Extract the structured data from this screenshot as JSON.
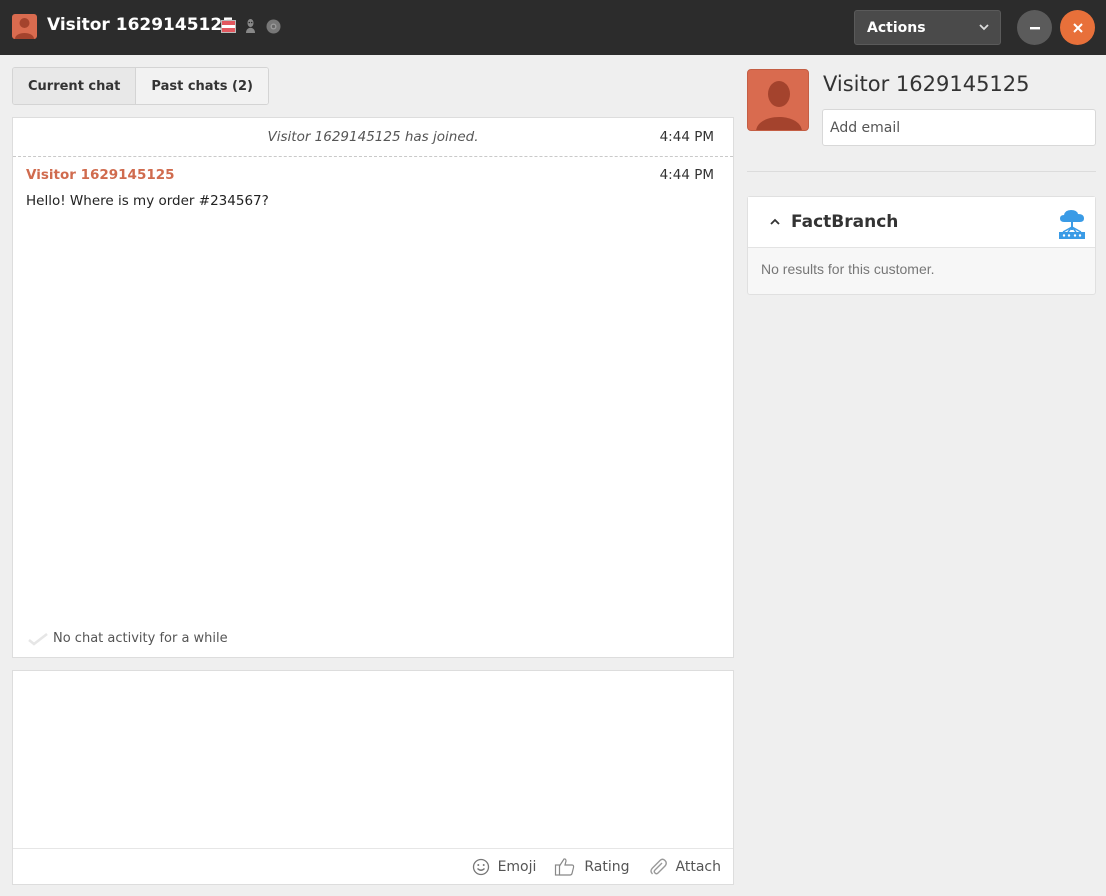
{
  "window": {
    "title": "Visitor 1629145125",
    "actions_label": "Actions"
  },
  "tabs": [
    {
      "label": "Current chat"
    },
    {
      "label": "Past chats (2)"
    }
  ],
  "chat": {
    "system_message": "Visitor 1629145125 has joined.",
    "system_time": "4:44 PM",
    "messages": [
      {
        "author": "Visitor 1629145125",
        "time": "4:44 PM",
        "text": "Hello! Where is my order #234567?"
      }
    ],
    "activity_note": "No chat activity for a while"
  },
  "composer": {
    "emoji_label": "Emoji",
    "rating_label": "Rating",
    "attach_label": "Attach"
  },
  "visitor": {
    "name": "Visitor 1629145125",
    "email_placeholder": "Add email"
  },
  "factbranch": {
    "title": "FactBranch",
    "empty_text": "No results for this customer."
  },
  "colors": {
    "titlebar": "#2c2c2c",
    "accent_orange": "#e8703a",
    "author": "#d06b4e",
    "avatar": "#d96b4f",
    "factbranch_blue": "#3a9be6"
  },
  "icons": [
    "visitor-avatar-icon",
    "flag-icon",
    "os-icon",
    "browser-icon",
    "chevron-down-icon",
    "minimize-icon",
    "close-icon",
    "check-icon",
    "emoji-icon",
    "thumbs-up-icon",
    "paperclip-icon",
    "caret-up-icon",
    "factbranch-logo-icon"
  ]
}
